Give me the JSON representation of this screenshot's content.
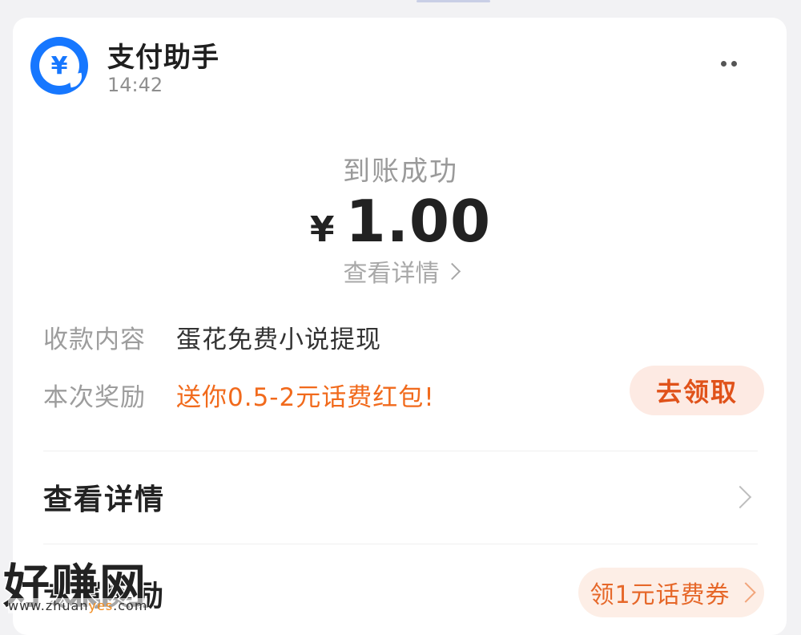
{
  "notification": {
    "app_name": "支付助手",
    "time": "14:42",
    "logo_glyph": "¥",
    "more_icon": "more-dots-icon"
  },
  "payment": {
    "status": "到账成功",
    "currency_symbol": "¥",
    "amount": "1.00",
    "view_detail_link": "查看详情"
  },
  "info": {
    "content_label": "收款内容",
    "content_value": "蛋花免费小说提现",
    "reward_label": "本次奖励",
    "reward_value": "送你0.5-2元话费红包!",
    "claim_button": "去领取"
  },
  "list": {
    "view_detail": "查看详情",
    "reward_row": "专属奖励",
    "coupon_button": "领1元话费券"
  },
  "watermark": {
    "main": "好赚网",
    "sub_prefix": "www.zhuan",
    "sub_accent": "yes",
    "sub_suffix": ".com"
  },
  "colors": {
    "brand_blue": "#1677ff",
    "reward_orange": "#f16a1c",
    "button_bg": "#fdeae3"
  }
}
